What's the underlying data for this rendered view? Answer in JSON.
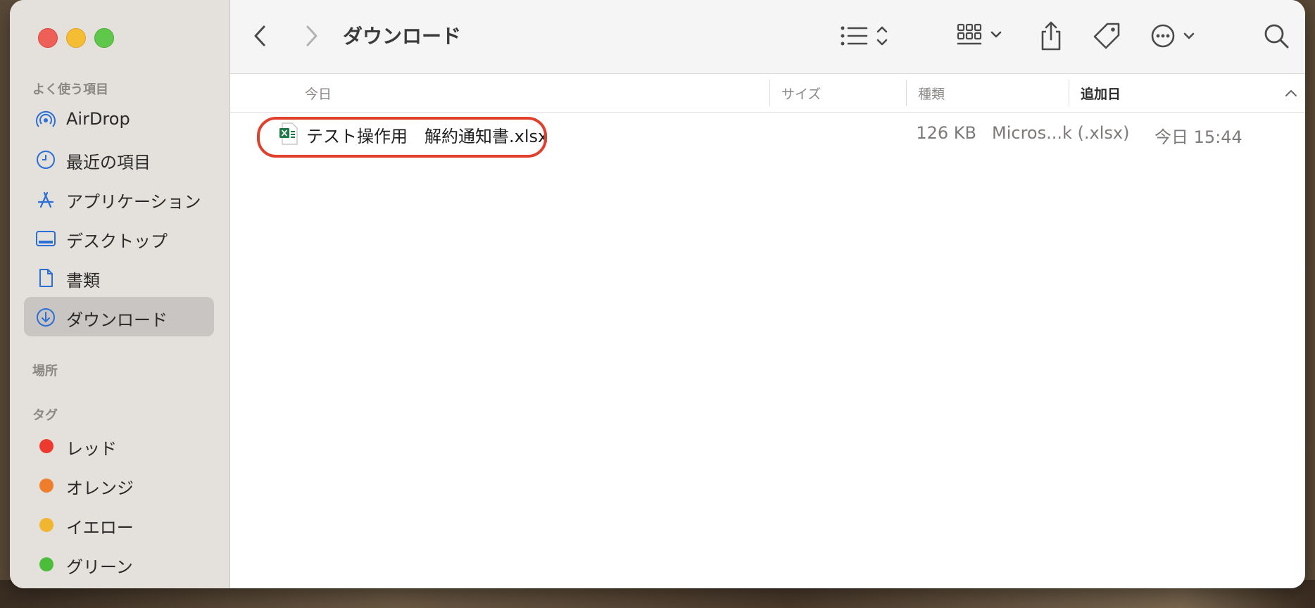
{
  "window": {
    "title": "ダウンロード"
  },
  "sidebar": {
    "favorites_label": "よく使う項目",
    "favorites": [
      {
        "label": "AirDrop",
        "icon": "airdrop-icon"
      },
      {
        "label": "最近の項目",
        "icon": "clock-icon"
      },
      {
        "label": "アプリケーション",
        "icon": "apps-icon"
      },
      {
        "label": "デスクトップ",
        "icon": "desktop-icon"
      },
      {
        "label": "書類",
        "icon": "document-icon"
      },
      {
        "label": "ダウンロード",
        "icon": "download-icon",
        "selected": true
      }
    ],
    "locations_label": "場所",
    "tags_label": "タグ",
    "tags": [
      {
        "label": "レッド",
        "color": "#ec3a2f"
      },
      {
        "label": "オレンジ",
        "color": "#ee7e2c"
      },
      {
        "label": "イエロー",
        "color": "#f0b630"
      },
      {
        "label": "グリーン",
        "color": "#4bbd3a"
      }
    ]
  },
  "toolbar": {
    "icons": [
      "back-icon",
      "forward-icon",
      "list-view-icon",
      "group-icon",
      "share-icon",
      "tag-icon",
      "more-icon",
      "search-icon"
    ]
  },
  "columns": {
    "name": "今日",
    "size": "サイズ",
    "kind": "種類",
    "date_added": "追加日"
  },
  "files": [
    {
      "name": "テスト操作用　解約通知書.xlsx",
      "size": "126 KB",
      "kind": "Micros...k (.xlsx)",
      "date_added": "今日 15:44",
      "icon": "excel-file-icon"
    }
  ],
  "colors": {
    "accent": "#2b6fd6",
    "highlight": "#e0402c"
  }
}
